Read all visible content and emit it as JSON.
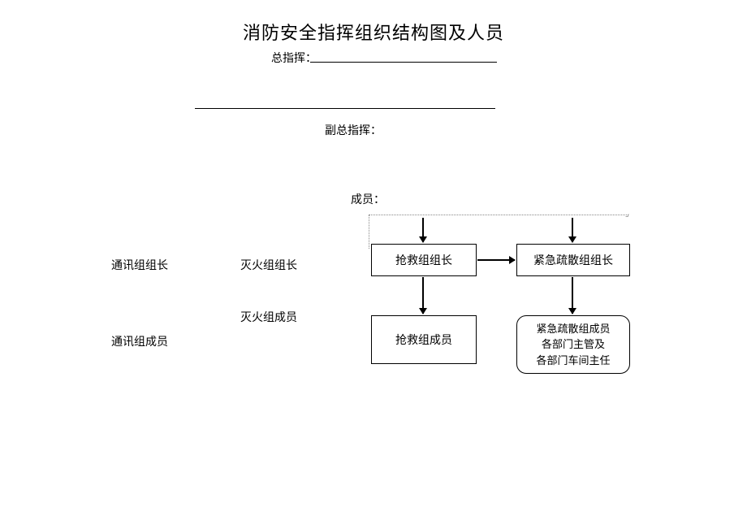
{
  "title": "消防安全指挥组织结构图及人员",
  "commander_label": "总指挥：",
  "deputy_label": "副总指挥：",
  "member_label": "成员：",
  "comm_leader": "通讯组组长",
  "fire_leader": "灭火组组长",
  "rescue_leader": "抢救组组长",
  "evac_leader": "紧急疏散组组长",
  "comm_member": "通讯组成员",
  "fire_member": "灭火组成员",
  "rescue_member": "抢救组成员",
  "evac_member_line1": "紧急疏散组成员",
  "evac_member_line2": "各部门主管及",
  "evac_member_line3": "各部门车间主任"
}
